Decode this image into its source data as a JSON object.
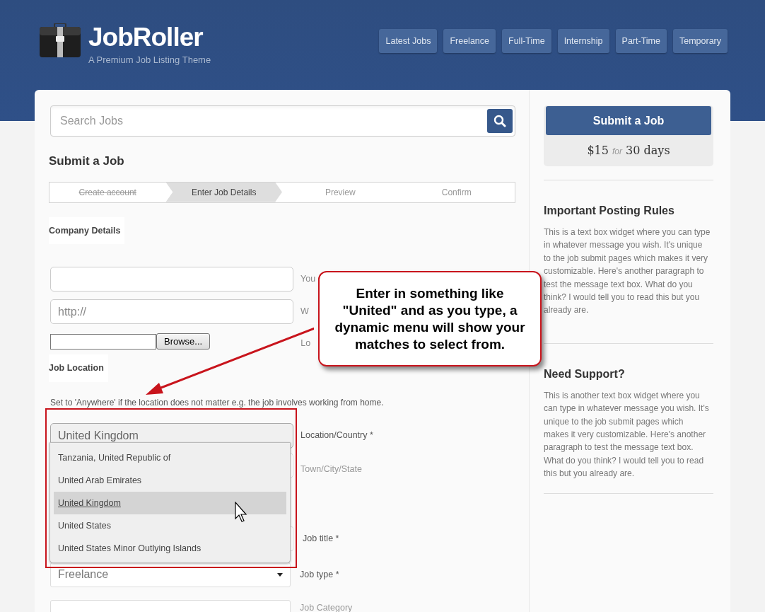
{
  "header": {
    "logo_title": "JobRoller",
    "tagline": "A Premium Job Listing Theme",
    "nav": [
      {
        "label": "Latest Jobs"
      },
      {
        "label": "Freelance"
      },
      {
        "label": "Full-Time"
      },
      {
        "label": "Internship"
      },
      {
        "label": "Part-Time"
      },
      {
        "label": "Temporary"
      }
    ]
  },
  "search": {
    "placeholder": "Search Jobs"
  },
  "page_title": "Submit a Job",
  "steps": [
    {
      "label": "Create account",
      "done": true,
      "selected": false
    },
    {
      "label": "Enter Job Details",
      "done": false,
      "selected": true
    },
    {
      "label": "Preview",
      "done": false,
      "selected": false
    },
    {
      "label": "Confirm",
      "done": false,
      "selected": false
    }
  ],
  "company_section": {
    "title": "Company Details",
    "fields": [
      {
        "kind": "text",
        "label": "You"
      },
      {
        "kind": "text",
        "placeholder": "http://",
        "label": "W"
      },
      {
        "kind": "file",
        "button": "Browse...",
        "label": "Lo"
      }
    ]
  },
  "location_section": {
    "title": "Job Location",
    "hint": "Set to 'Anywhere' if the location does not matter e.g. the job involves working from home.",
    "location": {
      "value": "United Kingdom",
      "label": "Location/Country *"
    },
    "town": {
      "label": "Town/City/State"
    },
    "suggestions": [
      {
        "label": "Tanzania, United Republic of",
        "selected": false
      },
      {
        "label": "United Arab Emirates",
        "selected": false
      },
      {
        "label": "United Kingdom",
        "selected": true
      },
      {
        "label": "United States",
        "selected": false
      },
      {
        "label": "United States Minor Outlying Islands",
        "selected": false
      }
    ]
  },
  "job_fields": [
    {
      "kind": "text",
      "label": "Job title *"
    },
    {
      "kind": "select",
      "value": "Freelance",
      "label": "Job type *"
    },
    {
      "kind": "select",
      "label": "Job Category"
    }
  ],
  "sidebar": {
    "submit_button": "Submit a Job",
    "price": "$15 *for* 30 days",
    "widgets": [
      {
        "title": "Important Posting Rules",
        "text": "This is a text box widget where you can type in whatever message you wish. It's unique to the job submit pages which makes it very customizable. Here's another paragraph to test the message text box. What do you think? I would tell you to read this but you already are."
      },
      {
        "title": "Need Support?",
        "text": "This is another text box widget where you can type in whatever message you wish. It's unique to the job submit pages which makes it very customizable. Here's another paragraph to test the message text box. What do you think? I would tell you to read this but you already are."
      }
    ]
  },
  "callout": {
    "text": "Enter in something like \"United\" and as you type, a dynamic menu will show your matches to select from."
  }
}
